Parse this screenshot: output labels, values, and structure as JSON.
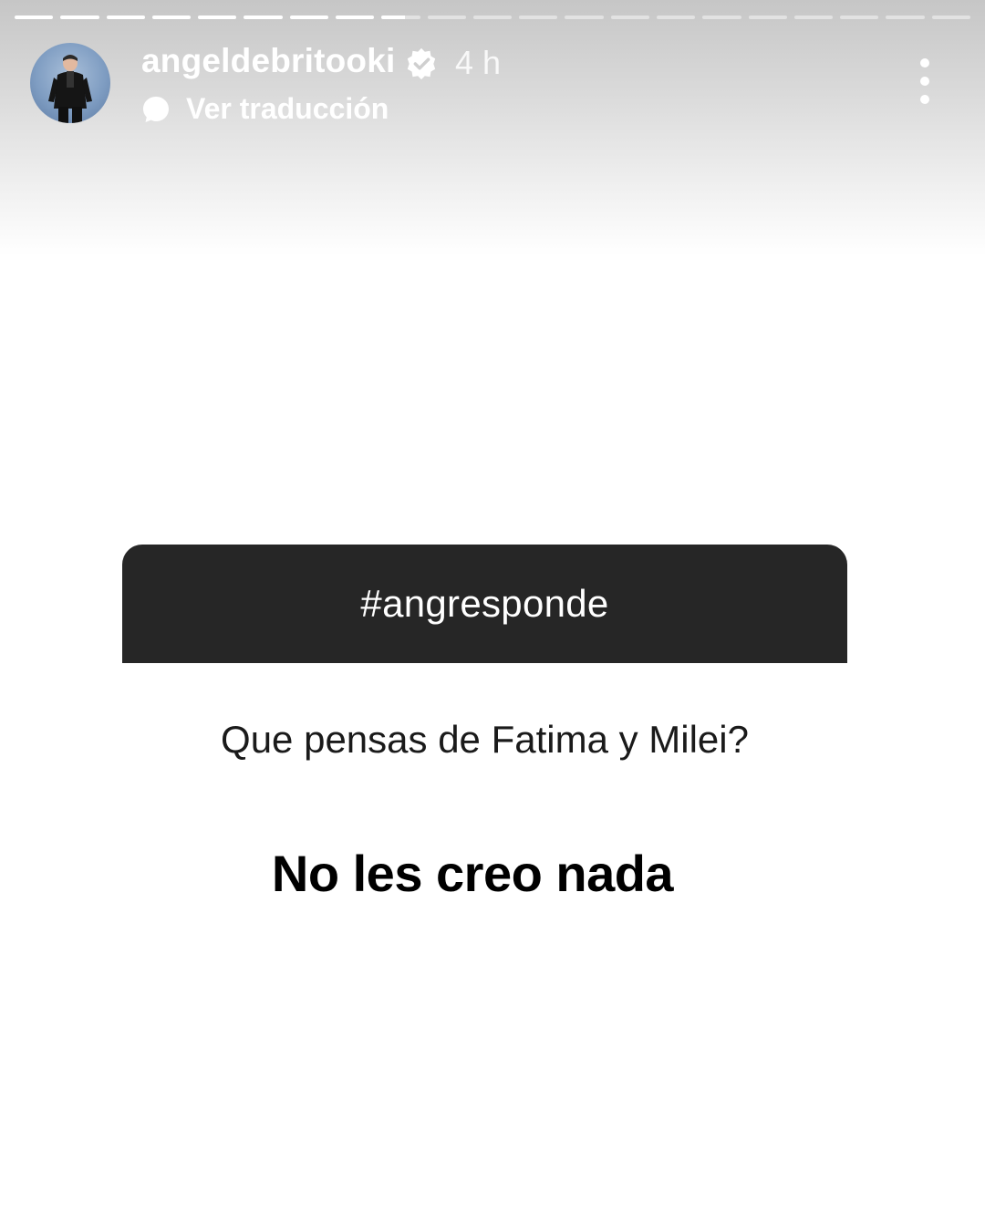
{
  "story": {
    "progress": {
      "total_segments": 21,
      "completed_segments": 8,
      "current_segment_fill": 0.6
    },
    "header": {
      "username": "angeldebritooki",
      "verified": true,
      "time": "4 h",
      "translate_label": "Ver traducción",
      "avatar_icon": "profile-avatar",
      "more_icon": "more-vertical-icon"
    },
    "question_sticker": {
      "title": "#angresponde",
      "question": "Que pensas de Fatima y Milei?"
    },
    "answer": "No les creo nada"
  },
  "colors": {
    "sticker_header_bg": "#262626",
    "header_text": "#ffffff",
    "answer_text": "#000000",
    "question_text": "#1a1a1a"
  }
}
